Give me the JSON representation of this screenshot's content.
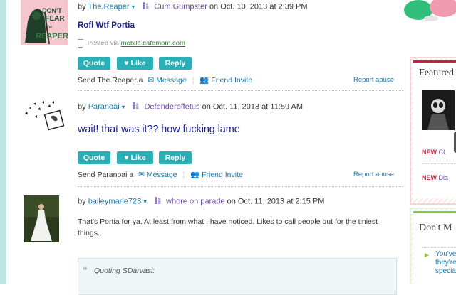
{
  "posts": [
    {
      "by_label": "by",
      "username": "The.Reaper",
      "group": "Cum Gumpster",
      "date": "on Oct. 10, 2013 at 2:39 PM",
      "title": "Rofl Wtf Portia",
      "posted_via_label": "Posted via",
      "posted_via_link": "mobile.cafemom.com",
      "avatar_text": [
        "DON'T",
        "FEAR",
        "the",
        "REAPER"
      ],
      "send_prefix": "Send The.Reaper a"
    },
    {
      "by_label": "by",
      "username": "Paranoai",
      "group": "Defenderoffetus",
      "date": "on Oct. 11, 2013 at 11:59 AM",
      "title": "wait! that was it?? how fucking lame",
      "send_prefix": "Send Paranoai a"
    },
    {
      "by_label": "by",
      "username": "baileymarie723",
      "group": "whore on parade",
      "date": "on Oct. 11, 2013 at 2:15 PM",
      "body": "That's Portia for ya. At least from what I have noticed. Likes to call people out for the tiniest things.",
      "quote_text": "Quoting SDarvasi:"
    }
  ],
  "actions": {
    "quote": "Quote",
    "like": "Like",
    "reply": "Reply",
    "message": "Message",
    "friend_invite": "Friend Invite",
    "report": "Report abuse"
  },
  "sidebar": {
    "featured_title": "Featured",
    "new1": "NEW",
    "new1_text": "CL",
    "new2": "NEW",
    "new2_text": "Dia",
    "dont_miss_title": "Don't M",
    "dont_miss_lines": [
      "You've",
      "they're",
      "specia"
    ]
  },
  "colors": {
    "accent_teal": "#28b0b6",
    "link_blue": "#1a78a8",
    "group_purple": "#6a4c9c",
    "title_navy": "#1b1b8a",
    "new_red": "#d81b3c",
    "green_border": "#8ec63f"
  }
}
